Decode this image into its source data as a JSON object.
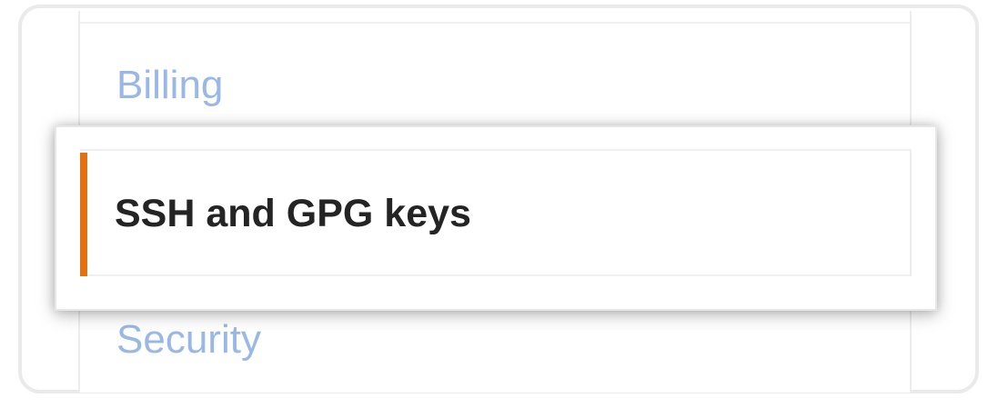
{
  "menu": {
    "items": [
      {
        "label": "Billing",
        "selected": false
      },
      {
        "label": "SSH and GPG keys",
        "selected": true
      },
      {
        "label": "Security",
        "selected": false
      }
    ],
    "selected_index": 1,
    "accent_color": "#e37112",
    "link_color": "#9ab8e5",
    "selected_text_color": "#242424"
  }
}
